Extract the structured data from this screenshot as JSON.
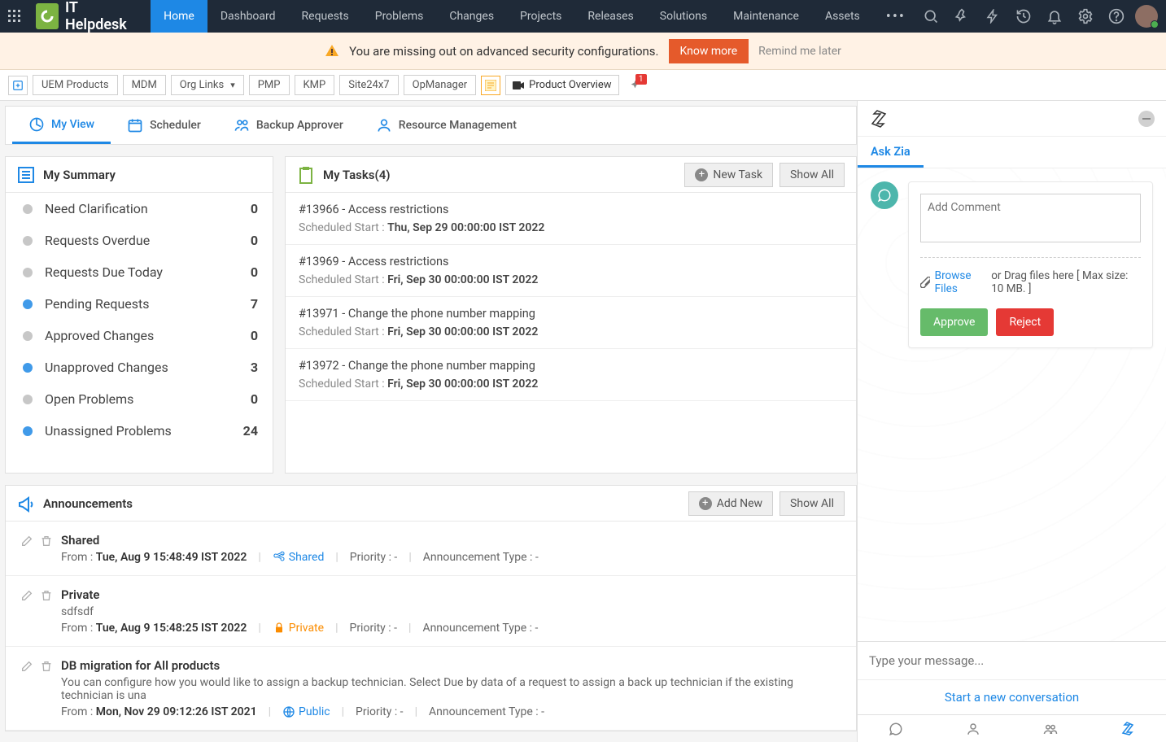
{
  "app": {
    "title": "IT Helpdesk"
  },
  "nav": {
    "items": [
      {
        "label": "Home",
        "active": true
      },
      {
        "label": "Dashboard"
      },
      {
        "label": "Requests"
      },
      {
        "label": "Problems"
      },
      {
        "label": "Changes"
      },
      {
        "label": "Projects"
      },
      {
        "label": "Releases"
      },
      {
        "label": "Solutions"
      },
      {
        "label": "Maintenance"
      },
      {
        "label": "Assets"
      }
    ],
    "more_icon": "…"
  },
  "banner": {
    "text": "You are missing out on advanced security configurations.",
    "know_more": "Know more",
    "remind": "Remind me later"
  },
  "linkbar": {
    "items": [
      "UEM Products",
      "MDM",
      "Org Links",
      "PMP",
      "KMP",
      "Site24x7",
      "OpManager"
    ],
    "product_overview": "Product Overview",
    "pin_badge": "1"
  },
  "view_tabs": {
    "items": [
      "My View",
      "Scheduler",
      "Backup Approver",
      "Resource Management"
    ],
    "active": 0
  },
  "summary": {
    "title": "My Summary",
    "rows": [
      {
        "label": "Need Clarification",
        "count": "0",
        "icon": "question"
      },
      {
        "label": "Requests Overdue",
        "count": "0",
        "icon": "overdue"
      },
      {
        "label": "Requests Due Today",
        "count": "0",
        "icon": "due"
      },
      {
        "label": "Pending Requests",
        "count": "7",
        "icon": "pending",
        "color": "#1e88e5"
      },
      {
        "label": "Approved Changes",
        "count": "0",
        "icon": "approved"
      },
      {
        "label": "Unapproved Changes",
        "count": "3",
        "icon": "unapproved",
        "color": "#1e88e5"
      },
      {
        "label": "Open Problems",
        "count": "0",
        "icon": "bug"
      },
      {
        "label": "Unassigned Problems",
        "count": "24",
        "icon": "bugs",
        "color": "#1e88e5"
      }
    ]
  },
  "tasks": {
    "title": "My Tasks(4)",
    "new_task": "New Task",
    "show_all": "Show All",
    "sched_label": "Scheduled Start :",
    "items": [
      {
        "title": "#13966 - Access restrictions",
        "date": "Thu, Sep 29 00:00:00 IST 2022"
      },
      {
        "title": "#13969 - Access restrictions",
        "date": "Fri, Sep 30 00:00:00 IST 2022"
      },
      {
        "title": "#13971 - Change the phone number mapping",
        "date": "Fri, Sep 30 00:00:00 IST 2022"
      },
      {
        "title": "#13972 - Change the phone number mapping",
        "date": "Fri, Sep 30 00:00:00 IST 2022"
      }
    ]
  },
  "announcements": {
    "title": "Announcements",
    "add_new": "Add New",
    "show_all": "Show All",
    "from_label": "From :",
    "priority_label": "Priority : -",
    "type_label": "Announcement Type : -",
    "items": [
      {
        "title": "Shared",
        "desc": "",
        "date": "Tue, Aug 9 15:48:49 IST 2022",
        "scope": "Shared",
        "scope_icon": "share",
        "scope_color": "#1e88e5"
      },
      {
        "title": "Private",
        "desc": "sdfsdf",
        "date": "Tue, Aug 9 15:48:25 IST 2022",
        "scope": "Private",
        "scope_icon": "lock",
        "scope_color": "#fb8c00"
      },
      {
        "title": "DB migration for All products",
        "desc": "You can configure how you would like to assign a backup technician. Select Due by data of a request to assign a back up technician if the existing technician is una",
        "date": "Mon, Nov 29 09:12:26 IST 2021",
        "scope": "Public",
        "scope_icon": "globe",
        "scope_color": "#1e88e5"
      }
    ]
  },
  "zia": {
    "tab": "Ask Zia",
    "comment_placeholder": "Add Comment",
    "browse": "Browse Files",
    "drag": " or Drag files here [ Max size: 10 MB. ]",
    "approve": "Approve",
    "reject": "Reject",
    "input_placeholder": "Type your message...",
    "start": "Start a new conversation"
  }
}
